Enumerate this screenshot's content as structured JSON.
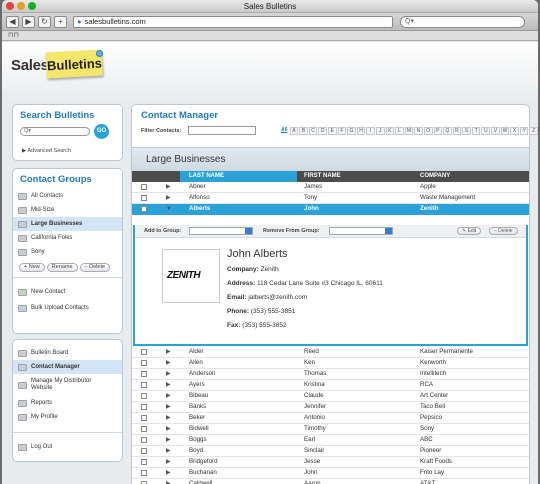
{
  "window": {
    "title": "Sales Bulletins"
  },
  "browser": {
    "url": "salesbulletins.com",
    "search_placeholder": "Q▾",
    "bookmarks_icon": "book-icon"
  },
  "brand": {
    "word1": "Sales",
    "word2": "Bulletins"
  },
  "search_panel": {
    "title": "Search Bulletins",
    "input_placeholder": "Q▾",
    "go": "GO",
    "advanced": "Advanced Search"
  },
  "groups_panel": {
    "title": "Contact Groups",
    "items": [
      {
        "label": "All Contacts",
        "selected": false
      },
      {
        "label": "Mid-Size",
        "selected": false
      },
      {
        "label": "Large Businesses",
        "selected": true
      },
      {
        "label": "California Folks",
        "selected": false
      },
      {
        "label": "Sony",
        "selected": false
      }
    ],
    "new": "+ New",
    "rename": "Rename",
    "delete": "– Delete",
    "actions": [
      "New Contact",
      "Bulk Upload Contacts"
    ]
  },
  "nav": {
    "items": [
      {
        "label": "Bulletin Board",
        "selected": false
      },
      {
        "label": "Contact Manager",
        "selected": true
      },
      {
        "label": "Manage My Distributor Website",
        "selected": false
      },
      {
        "label": "Reports",
        "selected": false
      },
      {
        "label": "My Profile",
        "selected": false
      }
    ],
    "logout": "Log Out"
  },
  "main": {
    "title": "Contact Manager",
    "filter_label": "Filter Contacts:",
    "letters": [
      "All",
      "A",
      "B",
      "C",
      "D",
      "E",
      "F",
      "G",
      "H",
      "I",
      "J",
      "K",
      "L",
      "M",
      "N",
      "O",
      "P",
      "Q",
      "R",
      "S",
      "T",
      "U",
      "V",
      "W",
      "X",
      "Y",
      "Z"
    ],
    "group_title": "Large Businesses",
    "columns": [
      "LAST NAME",
      "FIRST NAME",
      "COMPANY"
    ],
    "rows_top": [
      {
        "last": "Abner",
        "first": "James",
        "company": "Apple"
      },
      {
        "last": "Alfonso",
        "first": "Tony",
        "company": "Waste Management"
      },
      {
        "last": "Alberts",
        "first": "John",
        "company": "Zenith"
      }
    ],
    "detail": {
      "add_to_group": "Add to Group:",
      "remove_from_group": "Remove From Group:",
      "edit": "✎ Edit",
      "delete": "– Delete",
      "logo_text": "ZENITH",
      "name": "John Alberts",
      "company_label": "Company:",
      "company": "Zenith",
      "address_label": "Address:",
      "address": "118 Cedar Lane Suite #3 Chicago IL, 60611",
      "email_label": "Email:",
      "email": "jalberts@zenith.com",
      "phone_label": "Phone:",
      "phone": "(353) 555-3851",
      "fax_label": "Fax:",
      "fax": "(353) 555-3852"
    },
    "rows_bottom": [
      {
        "last": "Alder",
        "first": "Reed",
        "company": "Kaiser Permanente"
      },
      {
        "last": "Allen",
        "first": "Ken",
        "company": "Kenworth"
      },
      {
        "last": "Anderson",
        "first": "Thomas",
        "company": "Intellitech"
      },
      {
        "last": "Ayers",
        "first": "Kristina",
        "company": "RCA"
      },
      {
        "last": "Bibeau",
        "first": "Claude",
        "company": "Art Center"
      },
      {
        "last": "Banks",
        "first": "Jennifer",
        "company": "Taco Bell"
      },
      {
        "last": "Beker",
        "first": "Antonio",
        "company": "Pepsico"
      },
      {
        "last": "Bidwell",
        "first": "Timothy",
        "company": "Sony"
      },
      {
        "last": "Boggs",
        "first": "Earl",
        "company": "ABC"
      },
      {
        "last": "Boyd",
        "first": "Sinclair",
        "company": "Pioneer"
      },
      {
        "last": "Bridgeford",
        "first": "Jesse",
        "company": "Kraft Foods"
      },
      {
        "last": "Buchanan",
        "first": "John",
        "company": "Frito Lay"
      },
      {
        "last": "Caldwell",
        "first": "Aaron",
        "company": "AT&T"
      },
      {
        "last": "Collins",
        "first": "Kenny",
        "company": "Toyota"
      }
    ]
  }
}
